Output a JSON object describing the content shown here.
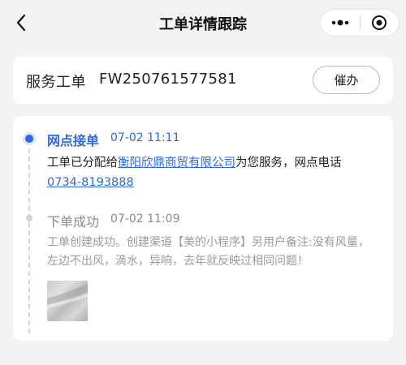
{
  "nav": {
    "title": "工单详情跟踪",
    "back_icon": "chevron-left-icon",
    "more_icon": "more-dots-icon",
    "close_icon": "target-close-icon"
  },
  "order": {
    "label": "服务工单",
    "number": "FW250761577581",
    "urge_label": "催办"
  },
  "timeline": {
    "events": [
      {
        "title": "网点接单",
        "time": "07-02 11:11",
        "desc_prefix": "工单已分配给",
        "branch_name": "衡阳欣鼎商贸有限公司",
        "desc_middle": "为您服务，网点电话",
        "phone": "0734-8193888",
        "status_color": "#2f69e4"
      },
      {
        "title": "下单成功",
        "time": "07-02 11:09",
        "desc": "工单创建成功。创建渠道【美的小程序】另用户备注:没有风量，左边不出风，滴水，异响，去年就反映过相同问题！",
        "status_color": "#8a8b8f"
      }
    ]
  }
}
